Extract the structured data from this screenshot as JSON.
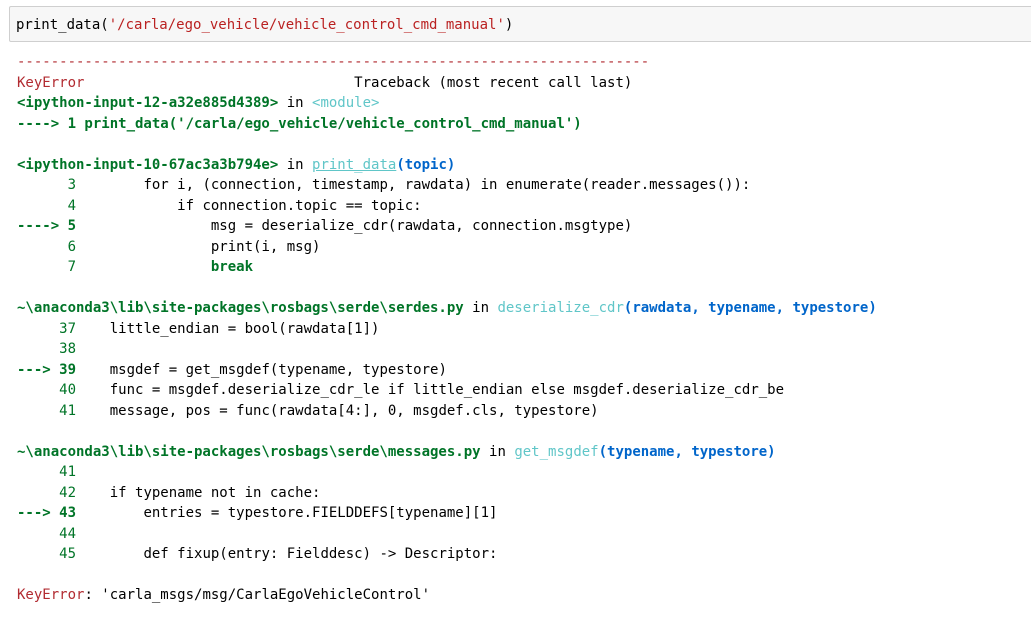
{
  "input_cell": {
    "func": "print_data",
    "arg": "'/carla/ego_vehicle/vehicle_control_cmd_manual'"
  },
  "traceback": {
    "separator": "---------------------------------------------------------------------------",
    "error_name": "KeyError",
    "header_right": "Traceback (most recent call last)",
    "frame1": {
      "location": "<ipython-input-12-a32e885d4389>",
      "in_word": " in ",
      "scope": "<module>",
      "arrow_line": "----> 1 print_data('/carla/ego_vehicle/vehicle_control_cmd_manual')"
    },
    "frame2": {
      "location": "<ipython-input-10-67ac3a3b794e>",
      "in_word": " in ",
      "func": "print_data",
      "args": "(topic)",
      "lines": [
        {
          "num": "      3",
          "code": "        for i, (connection, timestamp, rawdata) in enumerate(reader.messages()):"
        },
        {
          "num": "      4",
          "code": "            if connection.topic == topic:"
        },
        {
          "num": "----> 5",
          "code": "                msg = deserialize_cdr(rawdata, connection.msgtype)"
        },
        {
          "num": "      6",
          "code": "                print(i, msg)"
        },
        {
          "num": "      7",
          "code": "                break"
        }
      ]
    },
    "frame3": {
      "location": "~\\anaconda3\\lib\\site-packages\\rosbags\\serde\\serdes.py",
      "in_word": " in ",
      "func": "deserialize_cdr",
      "args": "(rawdata, typename, typestore)",
      "lines": [
        {
          "num": "     37",
          "code": "    little_endian = bool(rawdata[1])"
        },
        {
          "num": "     38",
          "code": ""
        },
        {
          "num": "---> 39",
          "code": "    msgdef = get_msgdef(typename, typestore)"
        },
        {
          "num": "     40",
          "code": "    func = msgdef.deserialize_cdr_le if little_endian else msgdef.deserialize_cdr_be"
        },
        {
          "num": "     41",
          "code": "    message, pos = func(rawdata[4:], 0, msgdef.cls, typestore)"
        }
      ]
    },
    "frame4": {
      "location": "~\\anaconda3\\lib\\site-packages\\rosbags\\serde\\messages.py",
      "in_word": " in ",
      "func": "get_msgdef",
      "args": "(typename, typestore)",
      "lines": [
        {
          "num": "     41",
          "code": ""
        },
        {
          "num": "     42",
          "code": "    if typename not in cache:"
        },
        {
          "num": "---> 43",
          "code": "        entries = typestore.FIELDDEFS[typename][1]"
        },
        {
          "num": "     44",
          "code": ""
        },
        {
          "num": "     45",
          "code": "        def fixup(entry: Fielddesc) -> Descriptor:"
        }
      ]
    },
    "final_error": {
      "name": "KeyError",
      "message": ": 'carla_msgs/msg/CarlaEgoVehicleControl'"
    }
  }
}
